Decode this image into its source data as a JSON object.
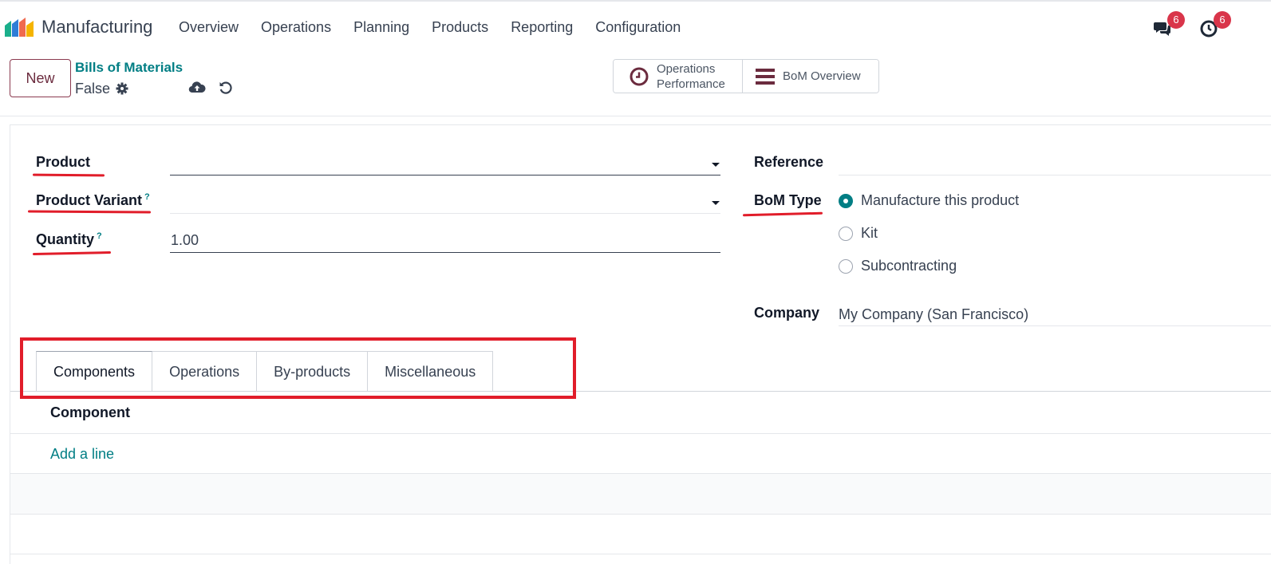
{
  "navbar": {
    "app_name": "Manufacturing",
    "menu": [
      "Overview",
      "Operations",
      "Planning",
      "Products",
      "Reporting",
      "Configuration"
    ],
    "messages_badge": "6",
    "activities_badge": "6",
    "brand_colors": [
      "#f06a4e",
      "#f5b400",
      "#1aaf8b",
      "#2e7dd7"
    ]
  },
  "control": {
    "new_button": "New",
    "breadcrumb_parent": "Bills of Materials",
    "breadcrumb_current": "False",
    "smart_buttons": {
      "operations_line1": "Operations",
      "operations_line2": "Performance",
      "bom_overview": "BoM Overview"
    }
  },
  "form": {
    "product_label": "Product",
    "product_value": "",
    "variant_label": "Product Variant",
    "variant_help": "?",
    "variant_value": "",
    "quantity_label": "Quantity",
    "quantity_help": "?",
    "quantity_value": "1.00",
    "reference_label": "Reference",
    "reference_value": "",
    "bom_type_label": "BoM Type",
    "bom_type_options": [
      "Manufacture this product",
      "Kit",
      "Subcontracting"
    ],
    "bom_type_selected": "Manufacture this product",
    "company_label": "Company",
    "company_value": "My Company (San Francisco)"
  },
  "tabs": [
    "Components",
    "Operations",
    "By-products",
    "Miscellaneous"
  ],
  "active_tab": "Components",
  "components": {
    "column_header": "Component",
    "add_line": "Add a line"
  },
  "colors": {
    "accent": "#017e84",
    "annotation_red": "#e11d2a",
    "badge": "#d9354a"
  }
}
